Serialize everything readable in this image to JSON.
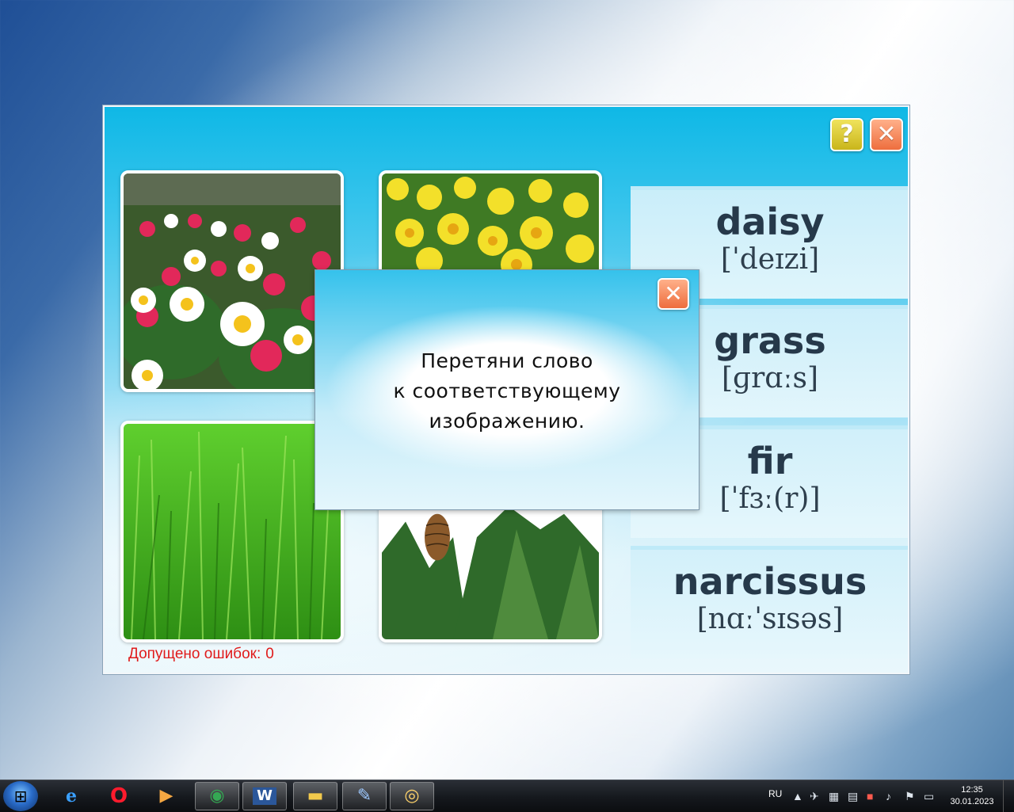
{
  "game": {
    "words": [
      {
        "word": "daisy",
        "ipa": "[ˈdeɪzi]"
      },
      {
        "word": "grass",
        "ipa": "[ɡrɑːs]"
      },
      {
        "word": "fir",
        "ipa": "[ˈfɜː(r)]"
      },
      {
        "word": "narcissus",
        "ipa": "[nɑːˈsɪsəs]"
      }
    ],
    "errors_label": "Допущено ошибок:",
    "errors_count": "0"
  },
  "dialog": {
    "lines": [
      "Перетяни слово",
      "к соответствующему",
      "изображению."
    ]
  },
  "taskbar": {
    "language": "RU",
    "time": "12:35",
    "date": "30.01.2023"
  },
  "colors": {
    "error_text": "#e01b1b",
    "word_text": "#26394a",
    "help_button": "#d9c52a",
    "close_button": "#ee6e3e"
  },
  "icons": [
    "help-icon",
    "close-icon",
    "windows-icon",
    "ie-icon",
    "opera-icon",
    "media-player-icon",
    "chrome-icon",
    "word-icon",
    "explorer-icon",
    "paint-icon",
    "eye-icon"
  ]
}
